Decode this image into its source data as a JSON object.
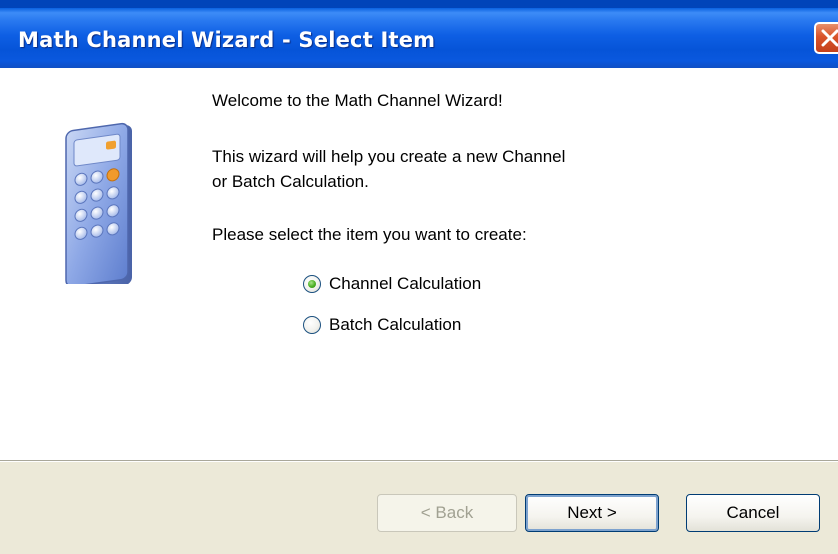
{
  "window": {
    "title": "Math Channel Wizard - Select Item"
  },
  "content": {
    "welcome": "Welcome to the Math Channel Wizard!",
    "description_line1": "This wizard will help you create a new Channel",
    "description_line2": "or Batch Calculation.",
    "prompt": "Please select the item you want to create:",
    "options": [
      {
        "label": "Channel Calculation",
        "selected": true
      },
      {
        "label": "Batch Calculation",
        "selected": false
      }
    ]
  },
  "buttons": {
    "back": "< Back",
    "back_enabled": false,
    "next": "Next >",
    "cancel": "Cancel"
  },
  "icons": {
    "wizard_icon": "calculator-icon",
    "close_icon": "close-icon"
  },
  "colors": {
    "titlebar": "#0a58de",
    "close_button": "#d9532a",
    "button_panel": "#ece9d8",
    "radio_selected": "#4cb024"
  }
}
